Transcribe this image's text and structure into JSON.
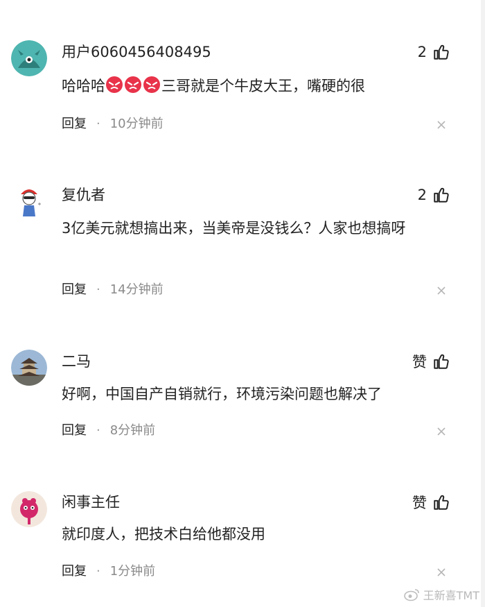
{
  "comments": [
    {
      "username": "用户6060456408495",
      "likes": "2",
      "text_before": "哈哈哈",
      "text_after": "三哥就是个牛皮大王，嘴硬的很",
      "emoji_count": 3,
      "reply_label": "回复",
      "dot": "·",
      "time": "10分钟前",
      "avatar_icon": "teal-monster-avatar"
    },
    {
      "username": "复仇者",
      "likes": "2",
      "text": "3亿美元就想搞出来，当美帝是没钱么？人家也想搞呀",
      "reply_label": "回复",
      "dot": "·",
      "time": "14分钟前",
      "avatar_icon": "cartoon-character-avatar"
    },
    {
      "username": "二马",
      "likes": "赞",
      "text": "好啊，中国自产自销就行，环境污染问题也解决了",
      "reply_label": "回复",
      "dot": "·",
      "time": "8分钟前",
      "avatar_icon": "pagoda-avatar"
    },
    {
      "username": "闲事主任",
      "likes": "赞",
      "text": "就印度人，把技术白给他都没用",
      "reply_label": "回复",
      "dot": "·",
      "time": "1分钟前",
      "avatar_icon": "pink-monster-avatar"
    }
  ],
  "watermark": "王新喜TMT",
  "colors": {
    "text": "#222222",
    "meta": "#8a8a8a",
    "emoji_red": "#e8334a"
  }
}
